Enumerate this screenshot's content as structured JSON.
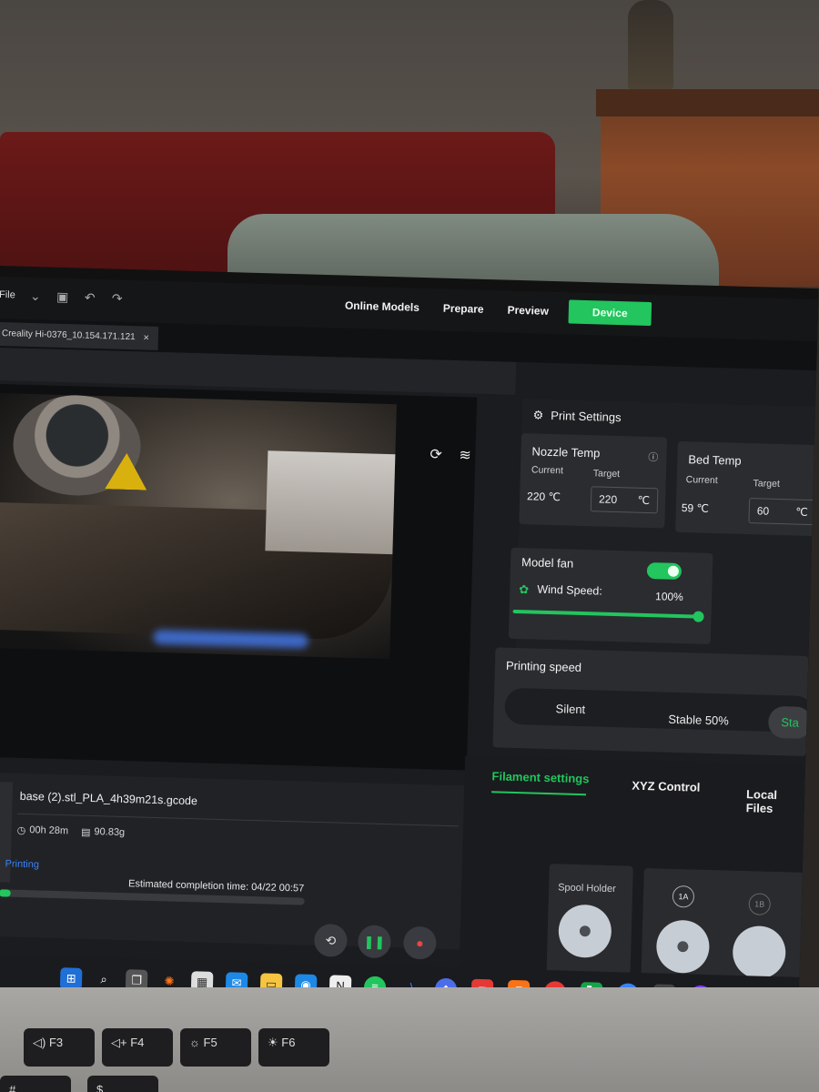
{
  "menu": {
    "file_label": "File"
  },
  "nav": {
    "items": [
      "Online Models",
      "Prepare",
      "Preview",
      "Device"
    ],
    "active": "Device"
  },
  "tab": {
    "title": "Creality Hi-0376_10.154.171.121",
    "close": "×"
  },
  "job": {
    "filename": "base (2).stl_PLA_4h39m21s.gcode",
    "time": "00h 28m",
    "weight": "90.83g",
    "status": "Printing",
    "eta": "Estimated completion time: 04/22 00:57",
    "progress_percent": 4
  },
  "print_settings": {
    "title": "Print Settings",
    "nozzle": {
      "title": "Nozzle Temp",
      "current_label": "Current",
      "target_label": "Target",
      "current": "220 ℃",
      "target": "220",
      "unit": "℃"
    },
    "bed": {
      "title": "Bed Temp",
      "current_label": "Current",
      "target_label": "Target",
      "current": "59 ℃",
      "target": "60",
      "unit": "℃"
    },
    "fan": {
      "title": "Model fan",
      "wind_label": "Wind Speed:",
      "wind_value": "100%",
      "enabled": true,
      "level_percent": 100
    },
    "speed": {
      "title": "Printing speed",
      "options": [
        "Silent",
        "Stable 50%",
        "Sta"
      ],
      "active": "Sta"
    }
  },
  "filament": {
    "tabs": [
      "Filament settings",
      "XYZ Control",
      "Local Files"
    ],
    "active_tab": "Filament settings",
    "spool_holder_label": "Spool Holder",
    "slots": [
      "1A",
      "1B"
    ]
  },
  "colors": {
    "accent": "#22c55e",
    "status_blue": "#3b82f6",
    "panel": "#2b2c30"
  }
}
